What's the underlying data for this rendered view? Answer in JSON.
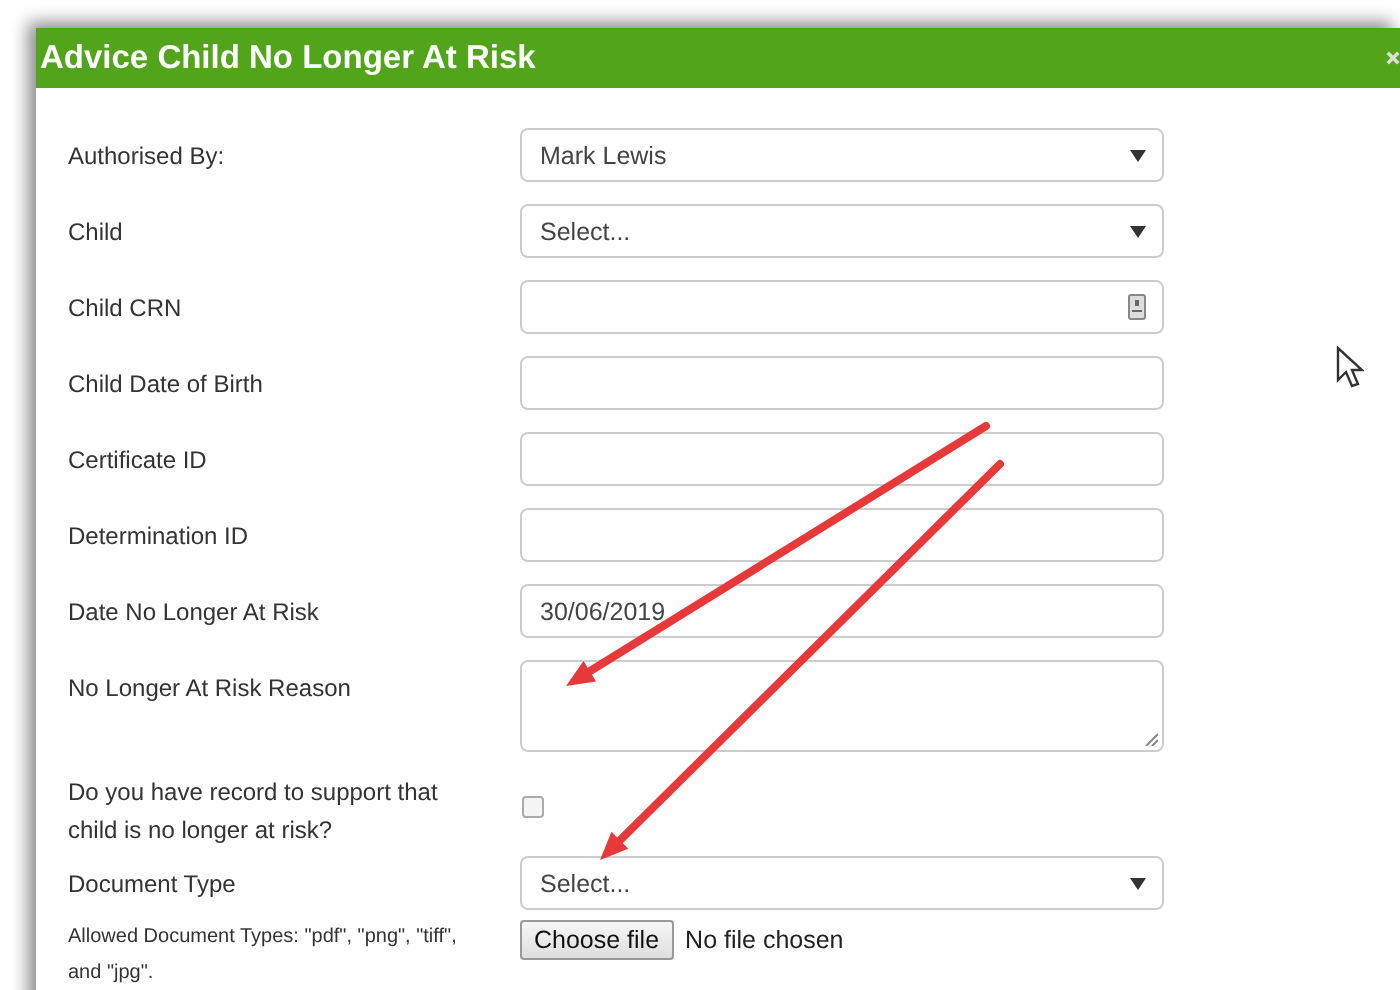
{
  "dialog": {
    "title": "Advice Child No Longer At Risk"
  },
  "fields": [
    {
      "label": "Authorised By:",
      "kind": "select",
      "value": "Mark Lewis"
    },
    {
      "label": "Child",
      "kind": "select",
      "value": "Select..."
    },
    {
      "label": "Child CRN",
      "kind": "lookup"
    },
    {
      "label": "Child Date of Birth",
      "kind": "text"
    },
    {
      "label": "Certificate ID",
      "kind": "text"
    },
    {
      "label": "Determination ID",
      "kind": "text"
    },
    {
      "label": "Date No Longer At Risk",
      "kind": "text",
      "value": "30/06/2019"
    },
    {
      "label": "No Longer At Risk Reason",
      "kind": "textarea"
    },
    {
      "label": "Do you have record to support that child is no longer at risk?",
      "kind": "checkbox",
      "checked": false
    },
    {
      "label": "Document Type",
      "kind": "select",
      "value": "Select..."
    },
    {
      "label": "Allowed Document Types: \"pdf\", \"png\", \"tiff\", and \"jpg\".",
      "kind": "file",
      "button": "Choose file",
      "status": "No file chosen"
    }
  ]
}
